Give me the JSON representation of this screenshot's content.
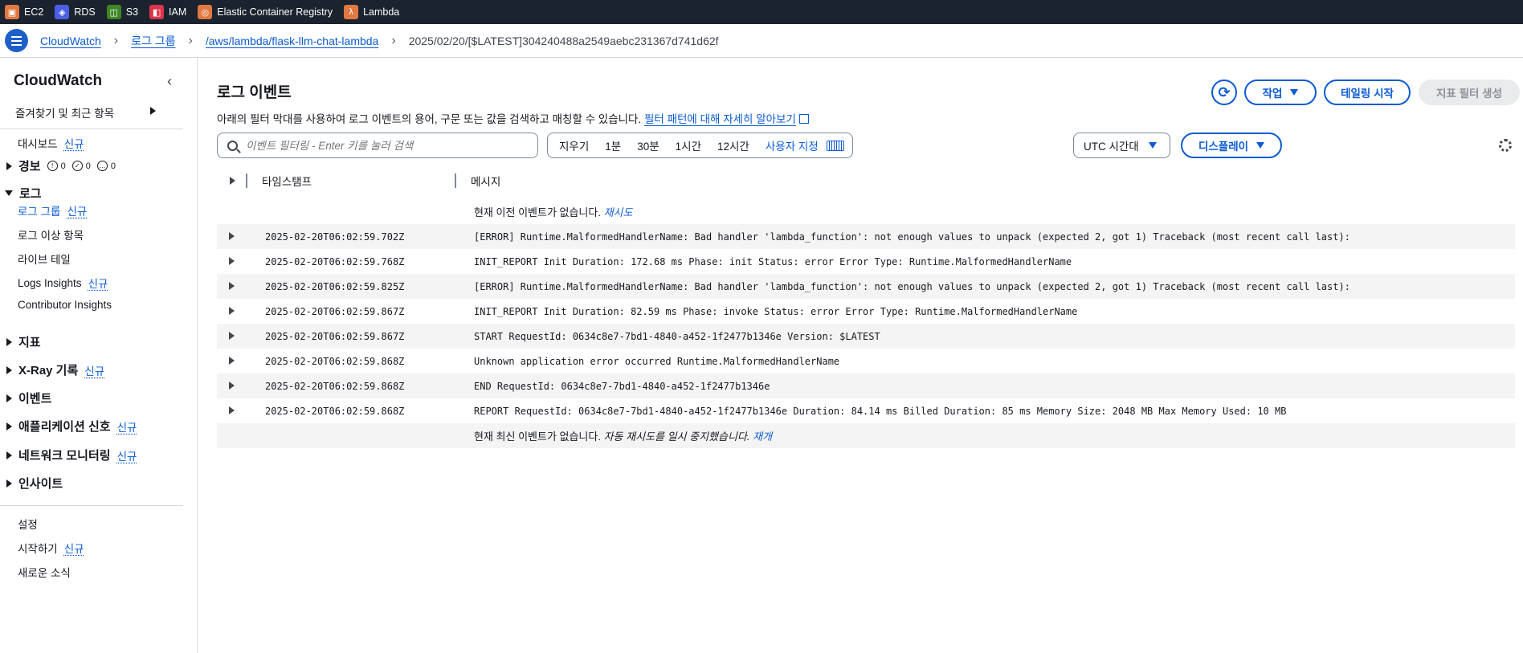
{
  "topbar": {
    "services": [
      {
        "label": "EC2",
        "color": "#e07941",
        "icon": "ec2-icon"
      },
      {
        "label": "RDS",
        "color": "#4d5ee6",
        "icon": "rds-icon"
      },
      {
        "label": "S3",
        "color": "#3f8624",
        "icon": "s3-icon"
      },
      {
        "label": "IAM",
        "color": "#dd344c",
        "icon": "iam-icon"
      },
      {
        "label": "Elastic Container Registry",
        "color": "#e07941",
        "icon": "ecr-icon"
      },
      {
        "label": "Lambda",
        "color": "#e07941",
        "icon": "lambda-icon"
      }
    ]
  },
  "breadcrumb": {
    "items": [
      "CloudWatch",
      "로그 그룹",
      "/aws/lambda/flask-llm-chat-lambda"
    ],
    "current": "2025/02/20/[$LATEST]304240488a2549aebc231367d741d62f"
  },
  "sidebar": {
    "title": "CloudWatch",
    "favorites": "즐겨찾기 및 최근 항목",
    "dashboard": "대시보드",
    "new_label": "신규",
    "alarms": "경보",
    "alarm_counts": [
      "0",
      "0",
      "0"
    ],
    "logs": "로그",
    "log_groups": "로그 그룹",
    "log_anomalies": "로그 이상 항목",
    "live_tail": "라이브 테일",
    "logs_insights": "Logs Insights",
    "contributor_insights": "Contributor Insights",
    "metrics": "지표",
    "xray": "X-Ray 기록",
    "events": "이벤트",
    "app_signals": "애플리케이션 신호",
    "network_monitoring": "네트워크 모니터링",
    "insights": "인사이트",
    "settings": "설정",
    "getting_started": "시작하기",
    "whats_new": "새로운 소식"
  },
  "main": {
    "title": "로그 이벤트",
    "description": "아래의 필터 막대를 사용하여 로그 이벤트의 용어, 구문 또는 값을 검색하고 매칭할 수 있습니다.",
    "learn_more": "필터 패턴에 대해 자세히 알아보기",
    "actions_label": "작업",
    "tail_label": "테일링 시작",
    "metric_filter_label": "지표 필터 생성",
    "search_placeholder": "이벤트 필터링 - Enter 키를 눌러 검색",
    "ranges": [
      "지우기",
      "1분",
      "30분",
      "1시간",
      "12시간"
    ],
    "custom_range": "사용자 지정",
    "timezone": "UTC 시간대",
    "display_label": "디스플레이",
    "col_timestamp": "타임스탬프",
    "col_message": "메시지",
    "no_older": "현재 이전 이벤트가 없습니다.",
    "retry": "재시도",
    "no_newer": "현재 최신 이벤트가 없습니다.",
    "auto_paused": "자동 재시도를 일시 중지했습니다.",
    "resume": "재개"
  },
  "events": [
    {
      "timestamp": "2025-02-20T06:02:59.702Z",
      "message": "[ERROR] Runtime.MalformedHandlerName: Bad handler 'lambda_function': not enough values to unpack (expected 2, got 1) Traceback (most recent call last):"
    },
    {
      "timestamp": "2025-02-20T06:02:59.768Z",
      "message": "INIT_REPORT Init Duration: 172.68 ms Phase: init Status: error Error Type: Runtime.MalformedHandlerName"
    },
    {
      "timestamp": "2025-02-20T06:02:59.825Z",
      "message": "[ERROR] Runtime.MalformedHandlerName: Bad handler 'lambda_function': not enough values to unpack (expected 2, got 1) Traceback (most recent call last):"
    },
    {
      "timestamp": "2025-02-20T06:02:59.867Z",
      "message": "INIT_REPORT Init Duration: 82.59 ms Phase: invoke Status: error Error Type: Runtime.MalformedHandlerName"
    },
    {
      "timestamp": "2025-02-20T06:02:59.867Z",
      "message": "START RequestId: 0634c8e7-7bd1-4840-a452-1f2477b1346e Version: $LATEST"
    },
    {
      "timestamp": "2025-02-20T06:02:59.868Z",
      "message": "Unknown application error occurred Runtime.MalformedHandlerName"
    },
    {
      "timestamp": "2025-02-20T06:02:59.868Z",
      "message": "END RequestId: 0634c8e7-7bd1-4840-a452-1f2477b1346e"
    },
    {
      "timestamp": "2025-02-20T06:02:59.868Z",
      "message": "REPORT RequestId: 0634c8e7-7bd1-4840-a452-1f2477b1346e Duration: 84.14 ms Billed Duration: 85 ms Memory Size: 2048 MB Max Memory Used: 10 MB"
    }
  ]
}
